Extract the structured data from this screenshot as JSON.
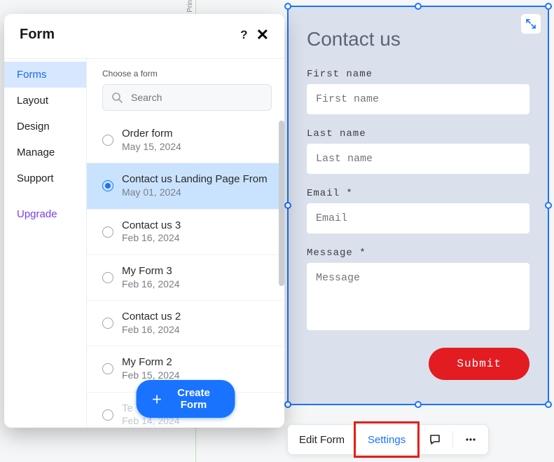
{
  "canvas": {
    "vline_label": "Prin"
  },
  "popover": {
    "title": "Form",
    "help": "?",
    "sidebar": {
      "items": [
        {
          "label": "Forms",
          "active": true
        },
        {
          "label": "Layout"
        },
        {
          "label": "Design"
        },
        {
          "label": "Manage"
        },
        {
          "label": "Support"
        }
      ],
      "upgrade_label": "Upgrade"
    },
    "choose_label": "Choose a form",
    "search_placeholder": "Search",
    "forms": [
      {
        "name": "Order form",
        "date": "May 15, 2024",
        "selected": false
      },
      {
        "name": "Contact us Landing Page From",
        "date": "May 01, 2024",
        "selected": true
      },
      {
        "name": "Contact us 3",
        "date": "Feb 16, 2024",
        "selected": false
      },
      {
        "name": "My Form 3",
        "date": "Feb 16, 2024",
        "selected": false
      },
      {
        "name": "Contact us 2",
        "date": "Feb 16, 2024",
        "selected": false
      },
      {
        "name": "My Form 2",
        "date": "Feb 15, 2024",
        "selected": false
      },
      {
        "name": "Te",
        "date": "Feb 14, 2024",
        "selected": false,
        "faded": true
      }
    ],
    "create_label": "Create Form"
  },
  "contact_form": {
    "title": "Contact us",
    "fields": {
      "first_name": {
        "label": "First name",
        "placeholder": "First name"
      },
      "last_name": {
        "label": "Last name",
        "placeholder": "Last name"
      },
      "email": {
        "label": "Email *",
        "placeholder": "Email"
      },
      "message": {
        "label": "Message *",
        "placeholder": "Message"
      }
    },
    "submit_label": "Submit"
  },
  "toolbar": {
    "edit_label": "Edit Form",
    "settings_label": "Settings",
    "more": "..."
  }
}
